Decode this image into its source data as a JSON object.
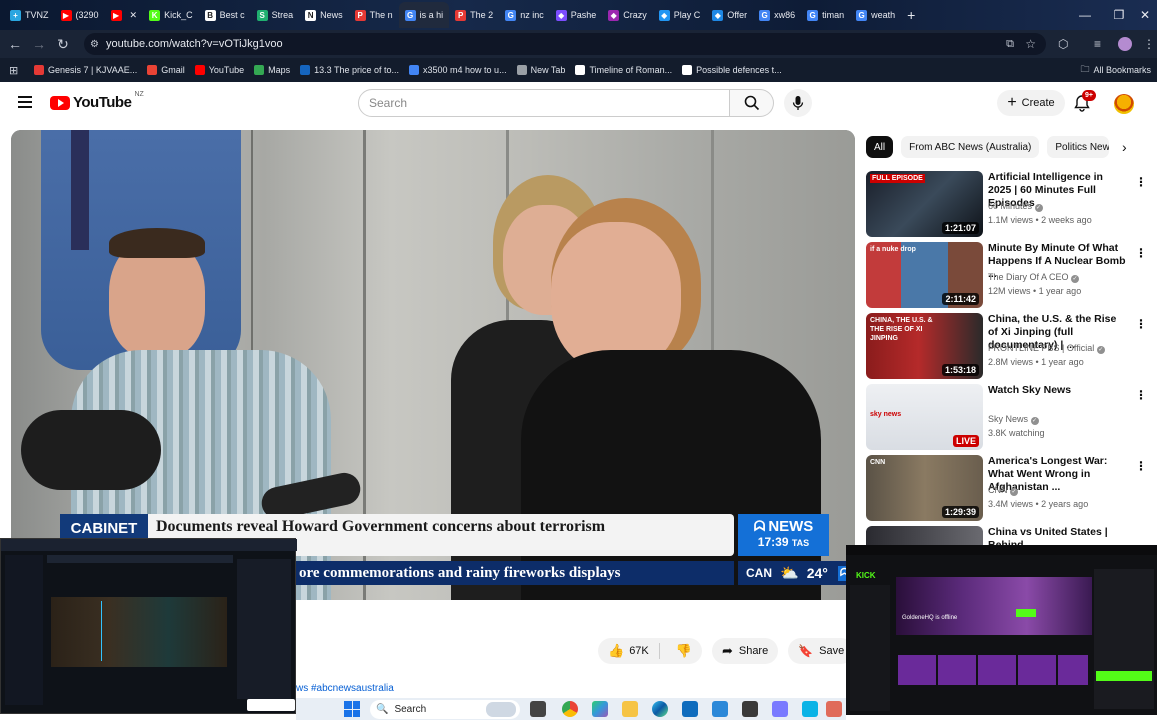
{
  "browser": {
    "tabs": [
      {
        "label": "TVNZ",
        "color": "#2aa6e0",
        "glyph": "+"
      },
      {
        "label": "(3290",
        "color": "#ff0000",
        "glyph": "▶"
      },
      {
        "label": "",
        "color": "#ff0000",
        "glyph": "▶"
      },
      {
        "label": "Kick_C",
        "color": "#53fc18",
        "glyph": "K"
      },
      {
        "label": "Best c",
        "color": "#ffffff",
        "glyph": "B"
      },
      {
        "label": "Strea",
        "color": "#20b070",
        "glyph": "S"
      },
      {
        "label": "News",
        "color": "#ffffff",
        "glyph": "N"
      },
      {
        "label": "The n",
        "color": "#e53935",
        "glyph": "P"
      },
      {
        "label": "is a hi",
        "color": "#4285f4",
        "glyph": "G"
      },
      {
        "label": "The 2",
        "color": "#e53935",
        "glyph": "P"
      },
      {
        "label": "nz inc",
        "color": "#4285f4",
        "glyph": "G"
      },
      {
        "label": "Pashe",
        "color": "#7c4dff",
        "glyph": "◆"
      },
      {
        "label": "Crazy",
        "color": "#9c27b0",
        "glyph": "◆"
      },
      {
        "label": "Play C",
        "color": "#2196f3",
        "glyph": "◆"
      },
      {
        "label": "Offer",
        "color": "#1e88e5",
        "glyph": "◆"
      },
      {
        "label": "xw86",
        "color": "#4285f4",
        "glyph": "G"
      },
      {
        "label": "timan",
        "color": "#4285f4",
        "glyph": "G"
      },
      {
        "label": "weath",
        "color": "#4285f4",
        "glyph": "G"
      }
    ],
    "url": "youtube.com/watch?v=vOTiJkg1voo",
    "bookmarks": [
      {
        "label": "Genesis 7 | KJVAAE...",
        "color": "#e53935"
      },
      {
        "label": "Gmail",
        "color": "#ea4335"
      },
      {
        "label": "YouTube",
        "color": "#ff0000"
      },
      {
        "label": "Maps",
        "color": "#34a853"
      },
      {
        "label": "13.3 The price of to...",
        "color": "#1565c0"
      },
      {
        "label": "x3500 m4 how to u...",
        "color": "#4285f4"
      },
      {
        "label": "New Tab",
        "color": "#9aa0a6"
      },
      {
        "label": "Timeline of Roman...",
        "color": "#ffffff"
      },
      {
        "label": "Possible defences t...",
        "color": "#ffffff"
      }
    ],
    "all_bookmarks": "All Bookmarks"
  },
  "youtube": {
    "logo": "YouTube",
    "region": "NZ",
    "search_placeholder": "Search",
    "create_label": "Create",
    "notif_count": "9+"
  },
  "video": {
    "cabinet_tag": "CABINET",
    "headline": "Documents reveal Howard Government concerns about terrorism",
    "ticker": "ore commemorations and rainy fireworks displays",
    "abc_news": "NEWS",
    "time": "17:39",
    "tz": "TAS",
    "city": "CAN",
    "temp": "24°"
  },
  "actions": {
    "likes": "67K",
    "share": "Share",
    "save": "Save"
  },
  "hashtag": "ws #abcnewsaustralia",
  "chips": [
    "All",
    "From ABC News (Australia)",
    "Politics News"
  ],
  "recommendations": [
    {
      "title": "Artificial Intelligence in 2025 | 60 Minutes Full Episodes",
      "channel": "60 Minutes",
      "meta": "1.1M views • 2 weeks ago",
      "duration": "1:21:07",
      "badge": "FULL EPISODE"
    },
    {
      "title": "Minute By Minute Of What Happens If A Nuclear Bomb ...",
      "channel": "The Diary Of A CEO",
      "meta": "12M views • 1 year ago",
      "duration": "2:11:42",
      "badge": "if a nuke drop"
    },
    {
      "title": "China, the U.S. & the Rise of Xi Jinping (full documentary) | ...",
      "channel": "FRONTLINE PBS | Official",
      "meta": "2.8M views • 1 year ago",
      "duration": "1:53:18",
      "badge": "CHINA, THE U.S. & THE RISE OF XI JINPING"
    },
    {
      "title": "Watch Sky News",
      "channel": "Sky News",
      "meta": "3.8K watching",
      "duration": "LIVE",
      "badge": "sky news"
    },
    {
      "title": "America's Longest War: What Went Wrong in Afghanistan ...",
      "channel": "CNN",
      "meta": "3.4M views • 2 years ago",
      "duration": "1:29:39",
      "badge": "CNN"
    },
    {
      "title": "China vs United States | Behind",
      "channel": "",
      "meta": "",
      "duration": "",
      "badge": ""
    }
  ],
  "taskbar": {
    "search": "Search"
  },
  "pip_right": {
    "profile": "GoldeneHQ is offline",
    "brand": "KICK"
  }
}
